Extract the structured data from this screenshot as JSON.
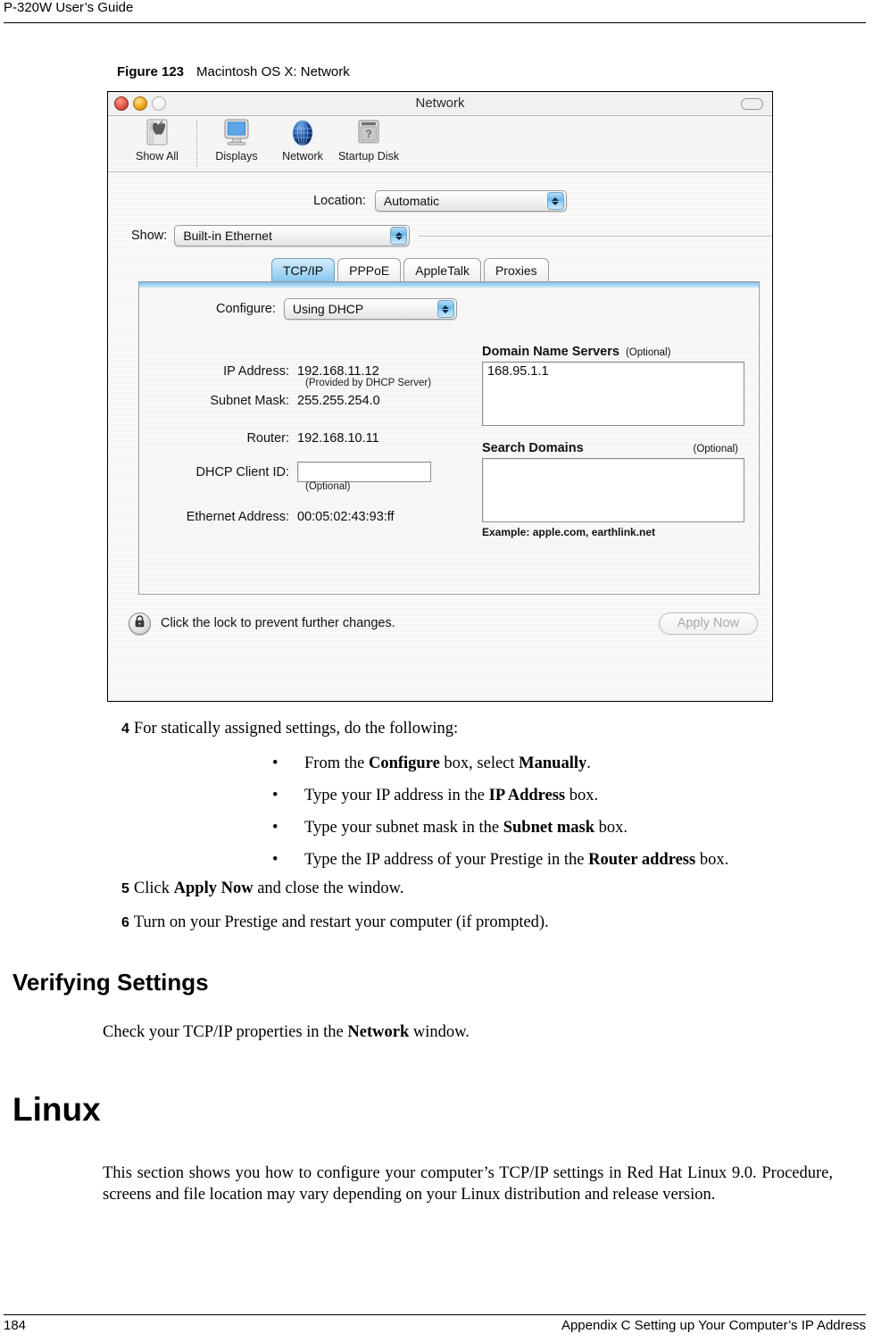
{
  "page": {
    "running_head": "P-320W User’s Guide",
    "footer_page_number": "184",
    "footer_section": "Appendix C Setting up Your Computer’s IP Address"
  },
  "figure": {
    "number_label": "Figure 123",
    "caption": "Macintosh OS X: Network"
  },
  "mac_window": {
    "title": "Network",
    "traffic_lights": [
      "close-button",
      "minimize-button",
      "zoom-button"
    ],
    "toolbar": {
      "items": [
        {
          "label": "Show All",
          "icon": "show-all-icon"
        },
        {
          "label": "Displays",
          "icon": "display-monitor-icon"
        },
        {
          "label": "Network",
          "icon": "globe-icon"
        },
        {
          "label": "Startup Disk",
          "icon": "hard-disk-question-icon"
        }
      ]
    },
    "location": {
      "label": "Location:",
      "value": "Automatic"
    },
    "show": {
      "label": "Show:",
      "value": "Built-in Ethernet"
    },
    "tabs": [
      {
        "label": "TCP/IP",
        "active": true
      },
      {
        "label": "PPPoE",
        "active": false
      },
      {
        "label": "AppleTalk",
        "active": false
      },
      {
        "label": "Proxies",
        "active": false
      }
    ],
    "tcpip": {
      "configure_label": "Configure:",
      "configure_value": "Using DHCP",
      "ip_address_label": "IP Address:",
      "ip_address_value": "192.168.11.12",
      "ip_address_note": "(Provided by DHCP Server)",
      "subnet_mask_label": "Subnet Mask:",
      "subnet_mask_value": "255.255.254.0",
      "router_label": "Router:",
      "router_value": "192.168.10.11",
      "dhcp_client_id_label": "DHCP Client ID:",
      "dhcp_client_id_value": "",
      "dhcp_client_id_note": "(Optional)",
      "ethernet_address_label": "Ethernet Address:",
      "ethernet_address_value": "00:05:02:43:93:ff",
      "dns_label": "Domain Name Servers",
      "dns_optional": "(Optional)",
      "dns_value": "168.95.1.1",
      "search_domains_label": "Search Domains",
      "search_domains_optional": "(Optional)",
      "search_domains_value": "",
      "example_note": "Example: apple.com, earthlink.net"
    },
    "footer": {
      "lock_icon": "padlock-icon",
      "lock_text": "Click the lock to prevent further changes.",
      "apply_button": "Apply Now",
      "apply_button_disabled": true
    },
    "accent_color": "#a9d8f4"
  },
  "content": {
    "step4": {
      "number": "4",
      "text": "For statically assigned settings, do the following:"
    },
    "bullets": [
      {
        "dot": "•",
        "pre": "From the ",
        "bold1": "Configure",
        "mid": " box, select ",
        "bold2": "Manually",
        "post": "."
      },
      {
        "dot": "•",
        "pre": "Type your IP address in the ",
        "bold1": "IP Address",
        "mid": " box.",
        "bold2": "",
        "post": ""
      },
      {
        "dot": "•",
        "pre": "Type your subnet mask in the ",
        "bold1": "Subnet mask",
        "mid": " box.",
        "bold2": "",
        "post": ""
      },
      {
        "dot": "•",
        "pre": "Type the IP address of your Prestige in the ",
        "bold1": "Router address",
        "mid": " box.",
        "bold2": "",
        "post": ""
      }
    ],
    "step5": {
      "number": "5",
      "pre": "Click ",
      "bold": "Apply Now",
      "post": " and close the window."
    },
    "step6": {
      "number": "6",
      "text": "Turn on your Prestige and restart your computer (if prompted)."
    },
    "heading_verifying": "Verifying Settings",
    "verify_para": {
      "pre": "Check your TCP/IP properties in the ",
      "bold": "Network",
      "post": " window."
    },
    "heading_linux": "Linux",
    "linux_para": "This section shows you how to configure your computer’s TCP/IP settings in Red Hat Linux 9.0. Procedure, screens and file location may vary depending on your Linux distribution and release version."
  }
}
